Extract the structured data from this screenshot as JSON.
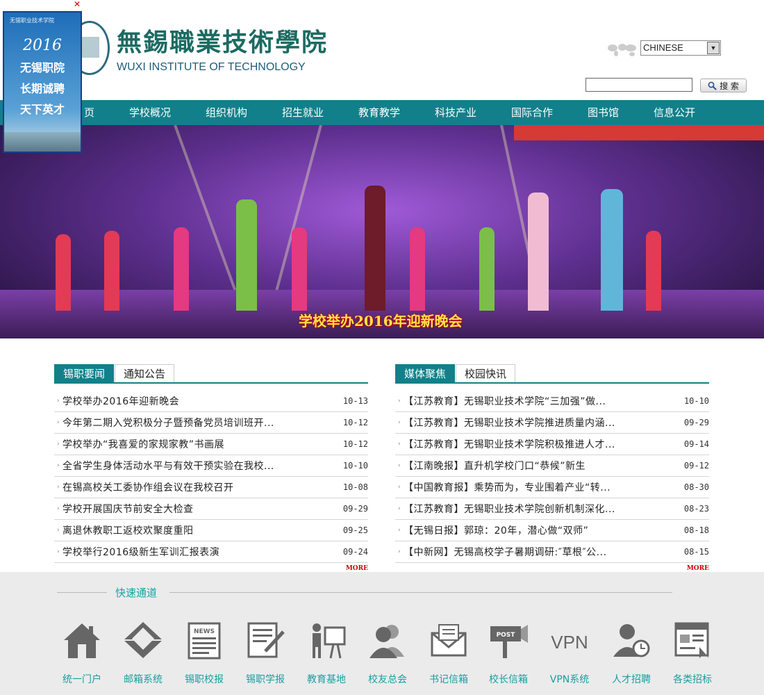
{
  "header": {
    "logo_cn": "無錫職業技術學院",
    "logo_en": "WUXI INSTITUTE OF TECHNOLOGY",
    "language": "CHINESE",
    "search_button": "搜 索",
    "search_value": ""
  },
  "ad": {
    "close": "✕",
    "small_text": "无锡职业技术学院",
    "year": "2016",
    "lines": [
      "无锡职院",
      "长期诚聘",
      "天下英才"
    ]
  },
  "nav": {
    "items": [
      "页",
      "学校概况",
      "组织机构",
      "招生就业",
      "教育教学",
      "科技产业",
      "国际合作",
      "图书馆",
      "信息公开"
    ]
  },
  "banner": {
    "caption": "学校举办2016年迎新晚会"
  },
  "news_left": {
    "tabs": [
      "锡职要闻",
      "通知公告"
    ],
    "active_tab": 0,
    "items": [
      {
        "title": "学校举办2016年迎新晚会",
        "date": "10-13"
      },
      {
        "title": "今年第二期入党积极分子暨预备党员培训班开...",
        "date": "10-12"
      },
      {
        "title": "学校举办“我喜爱的家规家教”书画展",
        "date": "10-12"
      },
      {
        "title": "全省学生身体活动水平与有效干预实验在我校...",
        "date": "10-10"
      },
      {
        "title": "在锡高校关工委协作组会议在我校召开",
        "date": "10-08"
      },
      {
        "title": "学校开展国庆节前安全大检查",
        "date": "09-29"
      },
      {
        "title": "离退休教职工返校欢聚度重阳",
        "date": "09-25"
      },
      {
        "title": "学校举行2016级新生军训汇报表演",
        "date": "09-24"
      }
    ],
    "more": "MORE"
  },
  "news_right": {
    "tabs": [
      "媒体聚焦",
      "校园快讯"
    ],
    "active_tab": 0,
    "items": [
      {
        "title": "【江苏教育】无锡职业技术学院“三加强”做...",
        "date": "10-10"
      },
      {
        "title": "【江苏教育】无锡职业技术学院推进质量内涵...",
        "date": "09-29"
      },
      {
        "title": "【江苏教育】无锡职业技术学院积极推进人才...",
        "date": "09-14"
      },
      {
        "title": "【江南晚报】直升机学校门口“恭候”新生",
        "date": "09-12"
      },
      {
        "title": "【中国教育报】乘势而为，专业围着产业“转...",
        "date": "08-30"
      },
      {
        "title": "【江苏教育】无锡职业技术学院创新机制深化...",
        "date": "08-23"
      },
      {
        "title": "【无锡日报】郭琼：20年，潜心做“双师”",
        "date": "08-18"
      },
      {
        "title": "【中新网】无锡高校学子暑期调研:″草根″公...",
        "date": "08-15"
      }
    ],
    "more": "MORE"
  },
  "quick": {
    "title": "快速通道",
    "items": [
      {
        "label": "统一门户",
        "icon": "home-icon"
      },
      {
        "label": "邮箱系统",
        "icon": "mail-envelope-icon"
      },
      {
        "label": "锡职校报",
        "icon": "newspaper-icon"
      },
      {
        "label": "锡职学报",
        "icon": "journal-edit-icon"
      },
      {
        "label": "教育基地",
        "icon": "teacher-board-icon"
      },
      {
        "label": "校友总会",
        "icon": "alumni-users-icon"
      },
      {
        "label": "书记信箱",
        "icon": "letter-mailbox-icon"
      },
      {
        "label": "校长信箱",
        "icon": "post-mailbox-icon"
      },
      {
        "label": "VPN系统",
        "icon": "vpn-icon"
      },
      {
        "label": "人才招聘",
        "icon": "recruit-clock-icon"
      },
      {
        "label": "各类招标",
        "icon": "bidding-page-icon"
      }
    ],
    "vpn_text": "VPN",
    "news_text": "NEWS",
    "post_text": "POST"
  }
}
